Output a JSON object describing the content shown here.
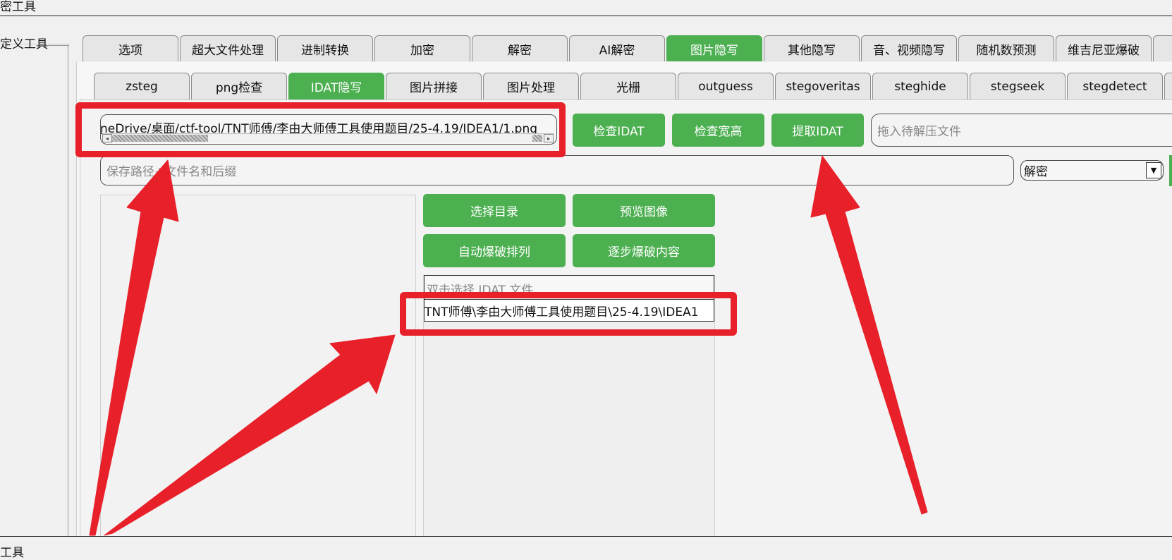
{
  "window": {
    "title_fragment": "密工具"
  },
  "left_sidebar": {
    "label": "定义工具"
  },
  "top_tabs": [
    {
      "label": "选项",
      "active": false
    },
    {
      "label": "超大文件处理",
      "active": false
    },
    {
      "label": "进制转换",
      "active": false
    },
    {
      "label": "加密",
      "active": false
    },
    {
      "label": "解密",
      "active": false
    },
    {
      "label": "AI解密",
      "active": false
    },
    {
      "label": "图片隐写",
      "active": true
    },
    {
      "label": "其他隐写",
      "active": false
    },
    {
      "label": "音、视频隐写",
      "active": false
    },
    {
      "label": "随机数预测",
      "active": false
    },
    {
      "label": "维吉尼亚爆破",
      "active": false
    }
  ],
  "sub_tabs": [
    {
      "label": "zsteg",
      "active": false
    },
    {
      "label": "png检查",
      "active": false
    },
    {
      "label": "IDAT隐写",
      "active": true
    },
    {
      "label": "图片拼接",
      "active": false
    },
    {
      "label": "图片处理",
      "active": false
    },
    {
      "label": "光栅",
      "active": false
    },
    {
      "label": "outguess",
      "active": false
    },
    {
      "label": "stegoveritas",
      "active": false
    },
    {
      "label": "steghide",
      "active": false
    },
    {
      "label": "stegseek",
      "active": false
    },
    {
      "label": "stegdetect",
      "active": false
    }
  ],
  "file_path_value": "neDrive/桌面/ctf-tool/TNT师傅/李由大师傅工具使用题目/25-4.19/IDEA1/1.png",
  "buttons": {
    "check_idat": "检查IDAT",
    "check_wh": "检查宽高",
    "extract_idat": "提取IDAT",
    "select_dir": "选择目录",
    "preview": "预览图像",
    "auto_brute": "自动爆破排列",
    "step_brute": "逐步爆破内容"
  },
  "drop_placeholder": "拖入待解压文件",
  "save_placeholder": "保存路径+文件名和后缀",
  "mode_select": {
    "value": "解密"
  },
  "idat_file": {
    "placeholder": "双击选择 IDAT 文件",
    "value": "TNT师傅\\李由大师傅工具使用题目\\25-4.19\\IDEA1"
  },
  "bottom_bar": {
    "title_fragment": "工具"
  },
  "colors": {
    "accent": "#4caf50",
    "annotation": "#e8202a"
  }
}
